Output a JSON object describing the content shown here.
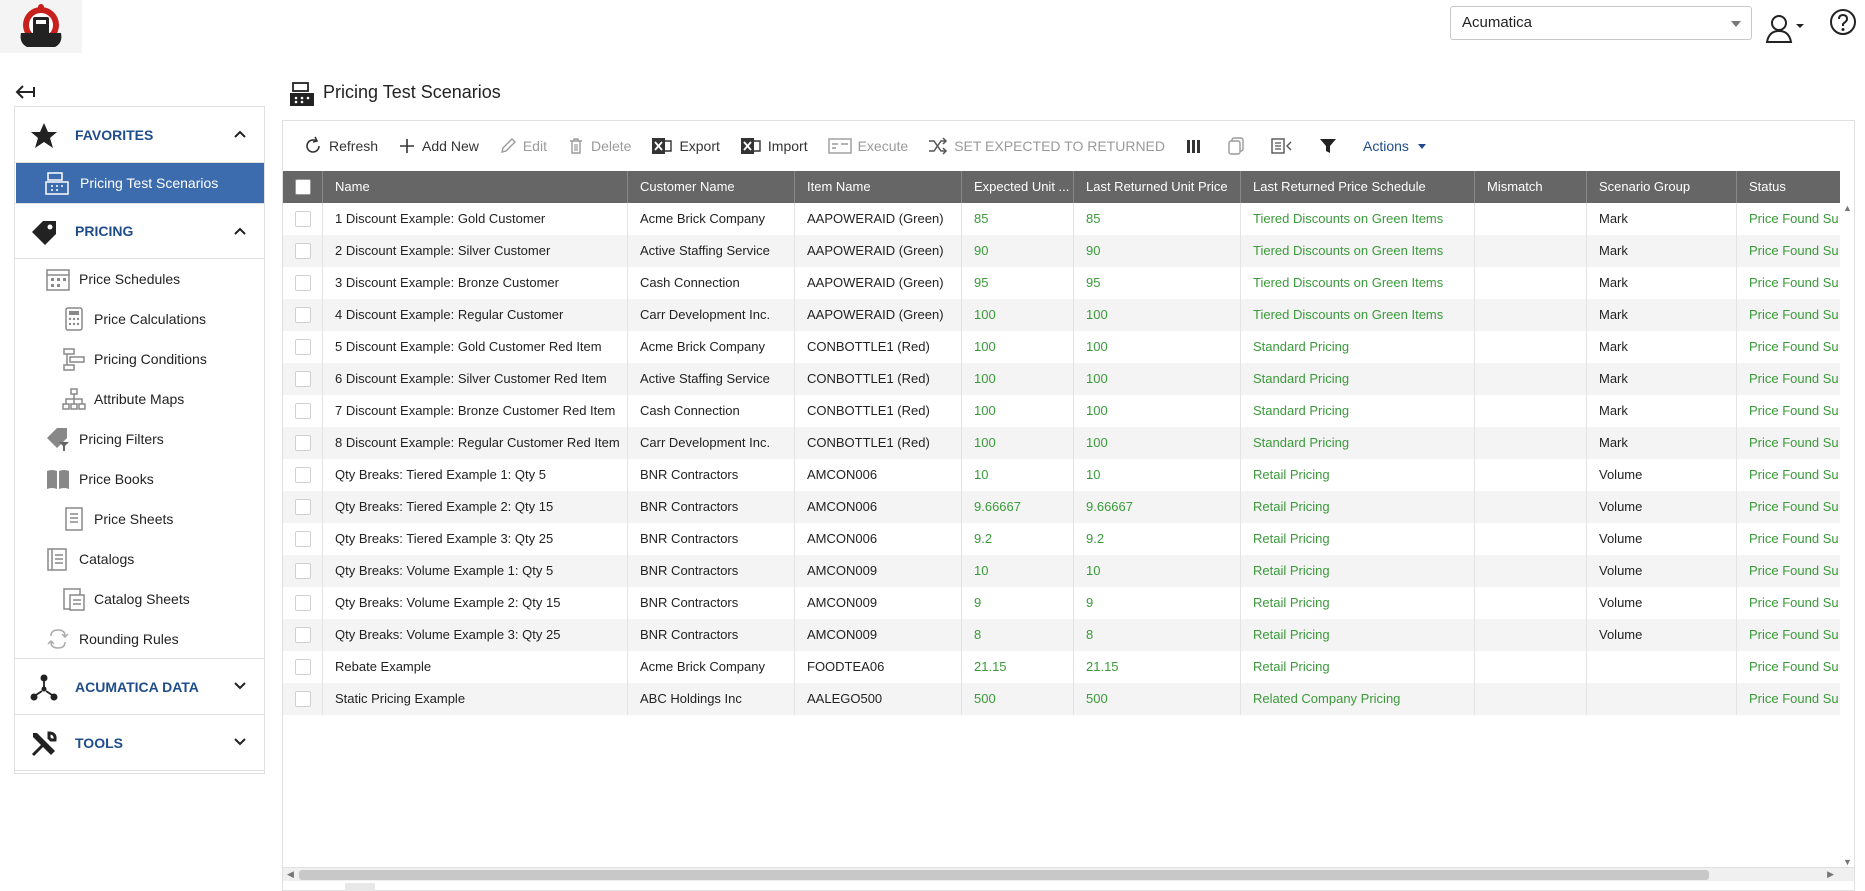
{
  "header": {
    "company": "Acumatica"
  },
  "sidebar": {
    "sections": {
      "favorites": "FAVORITES",
      "pricing": "PRICING",
      "acumatica_data": "ACUMATICA DATA",
      "tools": "TOOLS"
    },
    "favorites_items": [
      "Pricing Test Scenarios"
    ],
    "pricing_items": [
      "Price Schedules",
      "Price Calculations",
      "Pricing Conditions",
      "Attribute Maps",
      "Pricing Filters",
      "Price Books",
      "Price Sheets",
      "Catalogs",
      "Catalog Sheets",
      "Rounding Rules"
    ]
  },
  "page": {
    "title": "Pricing Test Scenarios"
  },
  "toolbar": {
    "refresh": "Refresh",
    "add_new": "Add New",
    "edit": "Edit",
    "delete": "Delete",
    "export": "Export",
    "import": "Import",
    "execute": "Execute",
    "set_expected": "SET EXPECTED TO RETURNED",
    "actions": "Actions"
  },
  "table": {
    "columns": [
      "Name",
      "Customer Name",
      "Item Name",
      "Expected Unit ...",
      "Last Returned Unit Price",
      "Last Returned Price Schedule",
      "Mismatch",
      "Scenario Group",
      "Status"
    ],
    "rows": [
      [
        "1 Discount Example: Gold Customer",
        "Acme Brick Company",
        "AAPOWERAID (Green)",
        "85",
        "85",
        "Tiered Discounts on Green Items",
        "",
        "Mark",
        "Price Found Su"
      ],
      [
        "2 Discount Example: Silver Customer",
        "Active Staffing Service",
        "AAPOWERAID (Green)",
        "90",
        "90",
        "Tiered Discounts on Green Items",
        "",
        "Mark",
        "Price Found Su"
      ],
      [
        "3 Discount Example: Bronze Customer",
        "Cash Connection",
        "AAPOWERAID (Green)",
        "95",
        "95",
        "Tiered Discounts on Green Items",
        "",
        "Mark",
        "Price Found Su"
      ],
      [
        "4 Discount Example: Regular Customer",
        "Carr Development Inc.",
        "AAPOWERAID (Green)",
        "100",
        "100",
        "Tiered Discounts on Green Items",
        "",
        "Mark",
        "Price Found Su"
      ],
      [
        "5 Discount Example: Gold Customer Red Item",
        "Acme Brick Company",
        "CONBOTTLE1 (Red)",
        "100",
        "100",
        "Standard Pricing",
        "",
        "Mark",
        "Price Found Su"
      ],
      [
        "6 Discount Example: Silver Customer Red Item",
        "Active Staffing Service",
        "CONBOTTLE1 (Red)",
        "100",
        "100",
        "Standard Pricing",
        "",
        "Mark",
        "Price Found Su"
      ],
      [
        "7 Discount Example: Bronze Customer Red Item",
        "Cash Connection",
        "CONBOTTLE1 (Red)",
        "100",
        "100",
        "Standard Pricing",
        "",
        "Mark",
        "Price Found Su"
      ],
      [
        "8 Discount Example: Regular Customer Red Item",
        "Carr Development Inc.",
        "CONBOTTLE1 (Red)",
        "100",
        "100",
        "Standard Pricing",
        "",
        "Mark",
        "Price Found Su"
      ],
      [
        "Qty Breaks: Tiered Example 1: Qty 5",
        "BNR Contractors",
        "AMCON006",
        "10",
        "10",
        "Retail Pricing",
        "",
        "Volume",
        "Price Found Su"
      ],
      [
        "Qty Breaks: Tiered Example 2: Qty 15",
        "BNR Contractors",
        "AMCON006",
        "9.66667",
        "9.66667",
        "Retail Pricing",
        "",
        "Volume",
        "Price Found Su"
      ],
      [
        "Qty Breaks: Tiered Example 3: Qty 25",
        "BNR Contractors",
        "AMCON006",
        "9.2",
        "9.2",
        "Retail Pricing",
        "",
        "Volume",
        "Price Found Su"
      ],
      [
        "Qty Breaks: Volume Example 1: Qty 5",
        "BNR Contractors",
        "AMCON009",
        "10",
        "10",
        "Retail Pricing",
        "",
        "Volume",
        "Price Found Su"
      ],
      [
        "Qty Breaks: Volume Example 2: Qty 15",
        "BNR Contractors",
        "AMCON009",
        "9",
        "9",
        "Retail Pricing",
        "",
        "Volume",
        "Price Found Su"
      ],
      [
        "Qty Breaks: Volume Example 3: Qty 25",
        "BNR Contractors",
        "AMCON009",
        "8",
        "8",
        "Retail Pricing",
        "",
        "Volume",
        "Price Found Su"
      ],
      [
        "Rebate Example",
        "Acme Brick Company",
        "FOODTEA06",
        "21.15",
        "21.15",
        "Retail Pricing",
        "",
        "",
        "Price Found Su"
      ],
      [
        "Static Pricing Example",
        "ABC Holdings Inc",
        "AALEGO500",
        "500",
        "500",
        "Related Company Pricing",
        "",
        "",
        "Price Found Su"
      ]
    ]
  },
  "colors": {
    "accent": "#3c6bae",
    "link": "#1f4d8c",
    "value_green": "#3a9a3a",
    "header_bg": "#666666"
  }
}
